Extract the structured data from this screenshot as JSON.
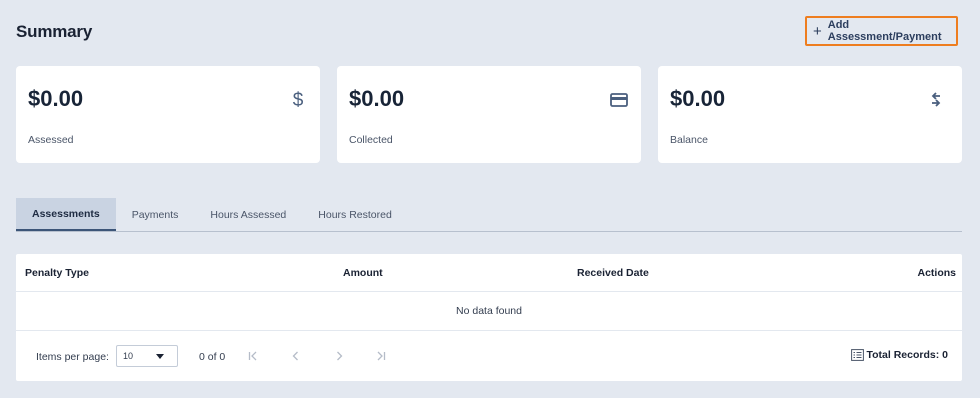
{
  "header": {
    "title": "Summary",
    "add_button_label": "Add Assessment/Payment"
  },
  "cards": [
    {
      "amount": "$0.00",
      "caption": "Assessed",
      "icon": "dollar-icon"
    },
    {
      "amount": "$0.00",
      "caption": "Collected",
      "icon": "credit-card-icon"
    },
    {
      "amount": "$0.00",
      "caption": "Balance",
      "icon": "balance-arrows-icon"
    }
  ],
  "tabs": [
    {
      "label": "Assessments",
      "active": true
    },
    {
      "label": "Payments",
      "active": false
    },
    {
      "label": "Hours Assessed",
      "active": false
    },
    {
      "label": "Hours Restored",
      "active": false
    }
  ],
  "table": {
    "columns": [
      "Penalty Type",
      "Amount",
      "Received Date",
      "Actions"
    ],
    "empty_message": "No data found"
  },
  "paginator": {
    "items_per_page_label": "Items per page:",
    "items_per_page_value": "10",
    "range_label": "0 of 0",
    "total_records_label": "Total Records: 0"
  },
  "colors": {
    "background": "#e3e8f0",
    "highlight_border": "#ee7d1f",
    "active_tab": "#c9d3e2"
  }
}
